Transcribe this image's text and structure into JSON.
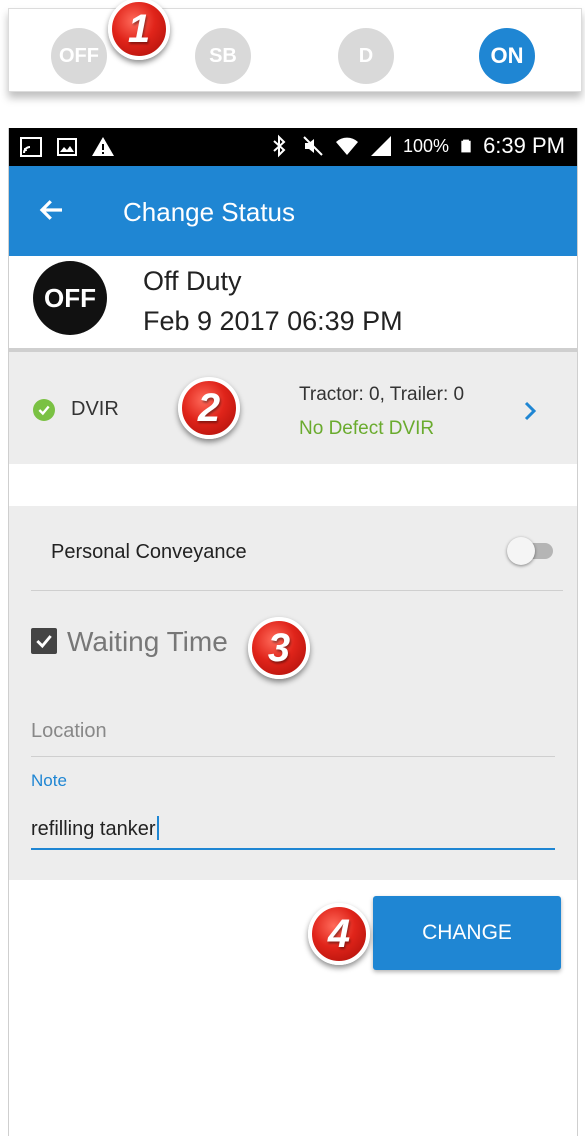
{
  "status_selector": {
    "options": [
      {
        "label": "OFF",
        "active": false
      },
      {
        "label": "SB",
        "active": false
      },
      {
        "label": "D",
        "active": false
      },
      {
        "label": "ON",
        "active": true
      }
    ]
  },
  "callouts": [
    "1",
    "2",
    "3",
    "4"
  ],
  "android_status_bar": {
    "battery": "100%",
    "time": "6:39 PM",
    "icons": [
      "screen-mirror-icon",
      "image-icon",
      "warning-icon",
      "bluetooth-icon",
      "mute-icon",
      "wifi-icon",
      "roaming-signal-icon",
      "battery-icon"
    ]
  },
  "app_bar": {
    "title": "Change Status",
    "back_icon": "arrow-left-icon"
  },
  "current_status": {
    "badge": "OFF",
    "name": "Off Duty",
    "timestamp": "Feb 9 2017 06:39 PM"
  },
  "dvir": {
    "label": "DVIR",
    "counts": "Tractor: 0, Trailer: 0",
    "result": "No Defect DVIR"
  },
  "form": {
    "personal_conveyance_label": "Personal Conveyance",
    "personal_conveyance_on": false,
    "waiting_time_label": "Waiting Time",
    "waiting_time_checked": true,
    "location_placeholder": "Location",
    "note_label": "Note",
    "note_value": "refilling tanker"
  },
  "actions": {
    "change_label": "CHANGE"
  },
  "colors": {
    "primary": "#1f86d3",
    "success": "#6aab2e",
    "inactive": "#d9d9d9"
  }
}
